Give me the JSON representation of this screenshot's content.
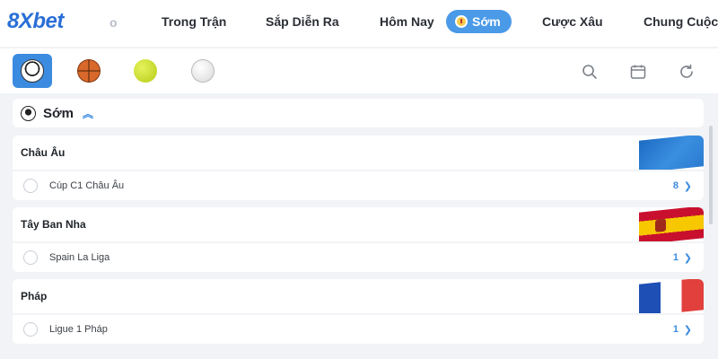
{
  "brand": {
    "logo_text": "8Xbet"
  },
  "nav": {
    "faded_item": "o",
    "tabs": [
      {
        "label": "Trong Trận"
      },
      {
        "label": "Sắp Diễn Ra"
      },
      {
        "label": "Hôm Nay"
      },
      {
        "label": "Sớm",
        "active": true
      },
      {
        "label": "Cược Xâu"
      },
      {
        "label": "Chung Cuộc"
      }
    ]
  },
  "sports": [
    {
      "icon": "soccer-ball-icon",
      "active": true
    },
    {
      "icon": "basketball-icon"
    },
    {
      "icon": "tennis-ball-icon"
    },
    {
      "icon": "baseball-icon"
    }
  ],
  "tools": [
    {
      "icon": "search-icon"
    },
    {
      "icon": "calendar-icon"
    },
    {
      "icon": "refresh-icon"
    }
  ],
  "section": {
    "title": "Sớm",
    "expanded": true
  },
  "regions": [
    {
      "name": "Châu Âu",
      "flag": "eu-flag-icon",
      "league": {
        "name": "Cúp C1 Châu Âu",
        "count": "8"
      }
    },
    {
      "name": "Tây Ban Nha",
      "flag": "spain-flag-icon",
      "league": {
        "name": "Spain La Liga",
        "count": "1"
      }
    },
    {
      "name": "Pháp",
      "flag": "france-flag-icon",
      "league": {
        "name": "Ligue 1 Pháp",
        "count": "1"
      }
    }
  ],
  "colors": {
    "accent": "#3b8be0",
    "active_tab": "#4a9ae8",
    "background": "#f1f3f6"
  }
}
